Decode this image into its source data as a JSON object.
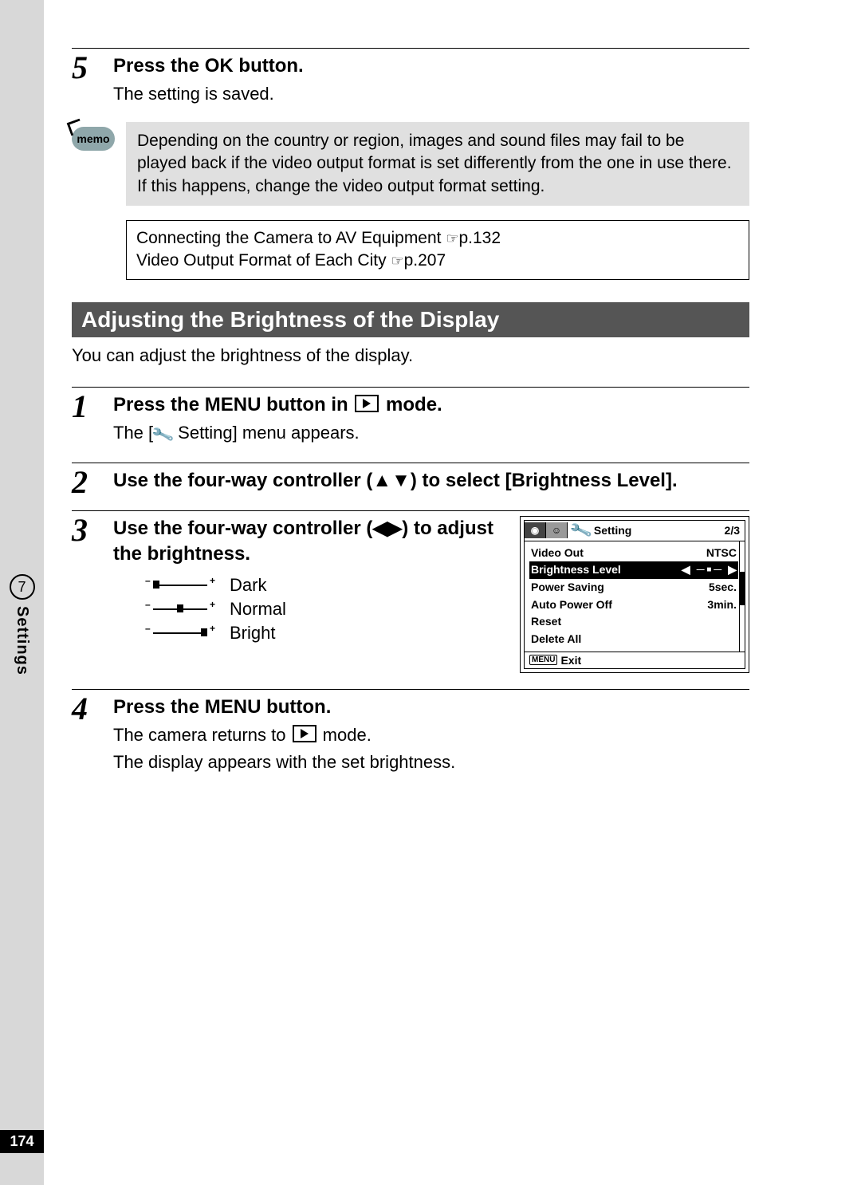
{
  "page_number": "174",
  "side_tab": {
    "chapter": "7",
    "label": "Settings"
  },
  "step5": {
    "num": "5",
    "title_pre": "Press the ",
    "title_ok": "OK",
    "title_post": " button.",
    "desc": "The setting is saved."
  },
  "memo": {
    "label": "memo",
    "text": "Depending on the country or region, images and sound files may fail to be played back if the video output format is set differently from the one in use there. If this happens, change the video output format setting."
  },
  "refs": {
    "line1_pre": "Connecting the Camera to AV Equipment ",
    "line1_page": "p.132",
    "line2_pre": "Video Output Format of Each City ",
    "line2_page": "p.207"
  },
  "section_title": "Adjusting the Brightness of the Display",
  "section_intro": "You can adjust the brightness of the display.",
  "step1": {
    "num": "1",
    "title_pre": "Press the ",
    "title_menu": "MENU",
    "title_mid": " button in ",
    "title_post": " mode.",
    "desc_pre": "The [",
    "desc_mid": " Setting] menu appears."
  },
  "step2": {
    "num": "2",
    "title": "Use the four-way controller (▲▼) to select [Brightness Level]."
  },
  "step3": {
    "num": "3",
    "title": "Use the four-way controller (◀▶) to adjust the brightness.",
    "levels": {
      "dark": "Dark",
      "normal": "Normal",
      "bright": "Bright"
    }
  },
  "step4": {
    "num": "4",
    "title_pre": "Press the ",
    "title_menu": "MENU",
    "title_post": " button.",
    "desc1_pre": "The camera returns to ",
    "desc1_post": " mode.",
    "desc2": "The display appears with the set brightness."
  },
  "lcd": {
    "title": "Setting",
    "page": "2/3",
    "rows": {
      "video_out": {
        "label": "Video Out",
        "value": "NTSC"
      },
      "brightness": {
        "label": "Brightness Level"
      },
      "power_saving": {
        "label": "Power Saving",
        "value": "5sec."
      },
      "auto_off": {
        "label": "Auto Power Off",
        "value": "3min."
      },
      "reset": {
        "label": "Reset"
      },
      "delete_all": {
        "label": "Delete All"
      }
    },
    "footer_btn": "MENU",
    "footer_label": "Exit"
  }
}
